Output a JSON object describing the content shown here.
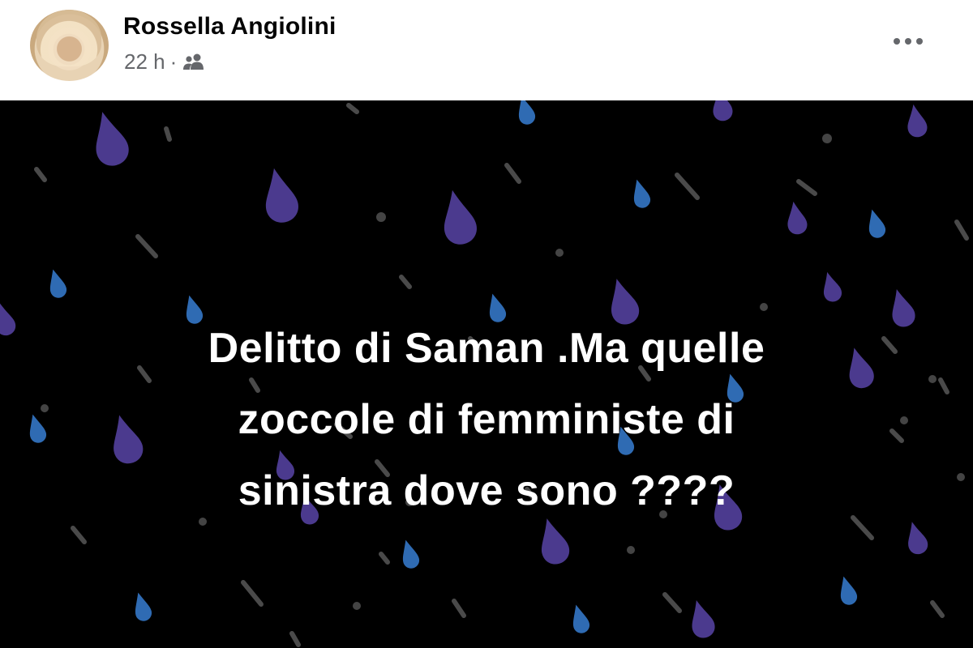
{
  "post": {
    "author": "Rossella Angiolini",
    "time": "22 h",
    "separator": "·",
    "audience_icon": "friends-icon",
    "more_icon": "more-options-icon",
    "text_lines": [
      "Delitto di Saman .Ma quelle",
      "zoccole di femministe di",
      "sinistra dove sono ????"
    ]
  },
  "colors": {
    "background": "#000000",
    "text": "#ffffff",
    "drop_purple": "#4b3a8e",
    "drop_blue": "#2f6bb3",
    "streak_gray": "#4a4a4a",
    "meta_gray": "#65676b"
  }
}
